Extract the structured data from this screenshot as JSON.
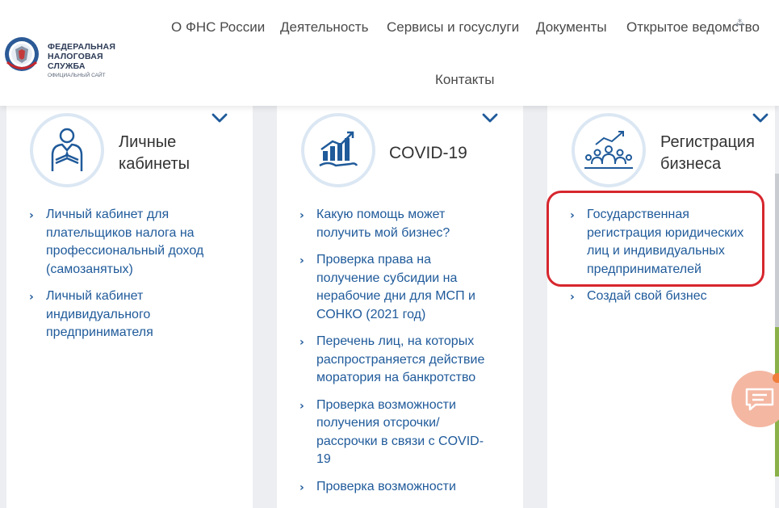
{
  "header": {
    "logo": {
      "line1": "ФЕДЕРАЛЬНАЯ",
      "line2": "НАЛОГОВАЯ СЛУЖБА",
      "subtitle": "ОФИЦИАЛЬНЫЙ САЙТ"
    },
    "nav": [
      "О ФНС России",
      "Деятельность",
      "Сервисы и госуслуги",
      "Документы",
      "Открытое ведомство",
      "Контакты"
    ]
  },
  "cards": [
    {
      "title": "Личные кабинеты",
      "icon": "person-icon",
      "links": [
        "Личный кабинет для плательщиков налога на профессиональный доход (самозанятых)",
        "Личный кабинет индивидуального предпринимателя"
      ]
    },
    {
      "title": "COVID-19",
      "icon": "growth-chart-icon",
      "links": [
        "Какую помощь может получить мой бизнес?",
        "Проверка права на получение субсидии на нерабочие дни для МСП и СОНКО (2021 год)",
        "Перечень лиц, на которых распространяется действие моратория на банкротство",
        "Проверка возможности получения отсрочки/ рассрочки в связи с COVID-19",
        "Проверка возможности"
      ]
    },
    {
      "title": "Регистрация бизнеса",
      "icon": "team-growth-icon",
      "links": [
        "Государственная регистрация юридических лиц и индивидуальных предпринимателей",
        "Создай свой бизнес"
      ]
    }
  ],
  "colors": {
    "link": "#1f5a9a",
    "highlight": "#d7262e",
    "icon_ring": "#dbe7f3",
    "background": "#eceef1"
  }
}
